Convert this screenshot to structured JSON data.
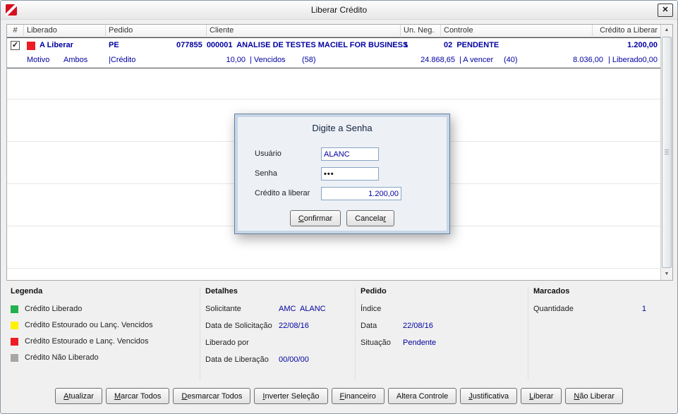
{
  "window": {
    "title": "Liberar Crédito",
    "close_glyph": "✕"
  },
  "icons": {
    "check": "✓",
    "scroll_up": "▲",
    "scroll_down": "▼"
  },
  "grid": {
    "headers": {
      "num": "#",
      "liberado": "Liberado",
      "pedido": "Pedido",
      "cliente": "Cliente",
      "un_neg": "Un. Neg.",
      "controle": "Controle",
      "credito": "Crédito a Liberar"
    },
    "row": {
      "status": "A Liberar",
      "status_color": "#ed1c24",
      "pedido": "PE",
      "cliente": "077855  000001  ANALISE DE TESTES MACIEL FOR BUSINESS",
      "un_neg": "1",
      "controle": "02  PENDENTE",
      "credito": "1.200,00"
    },
    "detail": {
      "motivo_label": "Motivo",
      "motivo_value": "Ambos",
      "credito_label": "|Crédito",
      "credito_value": "10,00",
      "vencidos_label": "| Vencidos",
      "vencidos_count": "(58)",
      "vencidos_value": "24.868,65",
      "avencer_label": "| A vencer",
      "avencer_count": "(40)",
      "avencer_value": "8.036,00",
      "liberado_label": "| Liberado",
      "liberado_value": "0,00"
    }
  },
  "modal": {
    "title": "Digite a Senha",
    "fields": {
      "usuario_label": "Usuário",
      "usuario_value": "ALANC",
      "senha_label": "Senha",
      "senha_value": "•••",
      "credito_label": "Crédito a liberar",
      "credito_value": "1.200,00"
    },
    "buttons": [
      {
        "label": "Confirmar",
        "key": "C"
      },
      {
        "label": "Cancelar",
        "key": "r"
      }
    ]
  },
  "legend": {
    "title": "Legenda",
    "items": [
      {
        "color": "#22b14c",
        "label": "Crédito Liberado"
      },
      {
        "color": "#fff200",
        "label": "Crédito Estourado ou Lanç. Vencidos"
      },
      {
        "color": "#ed1c24",
        "label": "Crédito Estourado e Lanç. Vencidos"
      },
      {
        "color": "#a6a6a6",
        "label": "Crédito Não Liberado"
      }
    ]
  },
  "detalhes": {
    "title": "Detalhes",
    "solicitante_label": "Solicitante",
    "solicitante_value": "AMC  ALANC",
    "data_solicitacao_label": "Data de Solicitação",
    "data_solicitacao_value": "22/08/16",
    "liberado_por_label": "Liberado por",
    "liberado_por_value": "",
    "data_liberacao_label": "Data de Liberação",
    "data_liberacao_value": "00/00/00"
  },
  "pedido": {
    "title": "Pedido",
    "indice_label": "Índice",
    "indice_value": "",
    "data_label": "Data",
    "data_value": "22/08/16",
    "situacao_label": "Situação",
    "situacao_value": "Pendente"
  },
  "marcados": {
    "title": "Marcados",
    "quantidade_label": "Quantidade",
    "quantidade_value": "1"
  },
  "actions": [
    {
      "label": "Atualizar",
      "key": "A"
    },
    {
      "label": "Marcar Todos",
      "key": "M"
    },
    {
      "label": "Desmarcar Todos",
      "key": "D"
    },
    {
      "label": "Inverter Seleção",
      "key": "I"
    },
    {
      "label": "Financeiro",
      "key": "F"
    },
    {
      "label": "Altera Controle",
      "key": ""
    },
    {
      "label": "Justificativa",
      "key": "J"
    },
    {
      "label": "Liberar",
      "key": "L"
    },
    {
      "label": "Não Liberar",
      "key": "N"
    }
  ]
}
